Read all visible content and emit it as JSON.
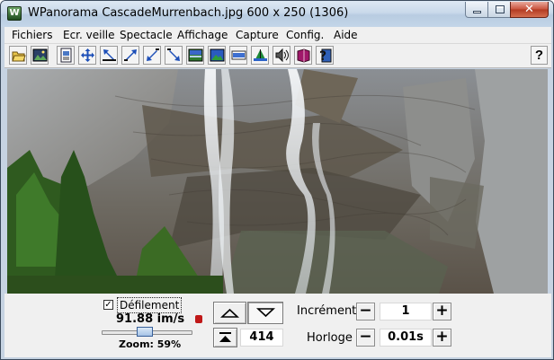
{
  "window": {
    "title": "WPanorama  CascadeMurrenbach.jpg   600 x 250 (1306)",
    "app_icon_letter": "W"
  },
  "menu": {
    "items": [
      {
        "label": "Fichiers"
      },
      {
        "label": "Ecr. veille"
      },
      {
        "label": "Spectacle"
      },
      {
        "label": "Affichage"
      },
      {
        "label": "Capture"
      },
      {
        "label": "Config."
      },
      {
        "label": "Aide"
      }
    ]
  },
  "toolbar": {
    "buttons": [
      {
        "icon": "open-file-icon"
      },
      {
        "icon": "picture-icon"
      },
      {
        "icon": "page-icon"
      },
      {
        "icon": "move-all-icon"
      },
      {
        "icon": "arrow-left-up-icon"
      },
      {
        "icon": "arrow-right-up-icon"
      },
      {
        "icon": "arrow-left-down-icon"
      },
      {
        "icon": "arrow-right-down-icon"
      },
      {
        "icon": "panorama-icon"
      },
      {
        "icon": "landscape-icon"
      },
      {
        "icon": "horizon-icon"
      },
      {
        "icon": "tripod-icon"
      },
      {
        "icon": "speaker-icon"
      },
      {
        "icon": "book-icon"
      },
      {
        "icon": "help-book-icon"
      }
    ],
    "help_label": "?"
  },
  "image": {
    "description_icon": "panorama-image"
  },
  "controls": {
    "scroll_checkbox_mark": "✓",
    "scroll_label": "Défilement",
    "speed": "91.88 im/s",
    "zoom_label": "Zoom: 59%",
    "zoom_fraction": 0.59,
    "position_value": "414",
    "increment_label": "Incrément",
    "increment_value": "1",
    "clock_label": "Horloge",
    "clock_value": "0.01s",
    "minus_symbol": "−",
    "plus_symbol": "+"
  },
  "colors": {
    "title_gradient_top": "#dde8f3",
    "close_button": "#c8513b",
    "face": "#f0f0f0"
  }
}
